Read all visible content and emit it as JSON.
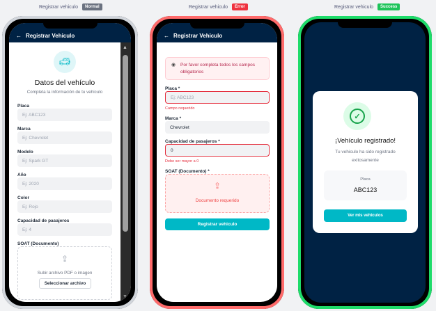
{
  "captions": [
    {
      "label": "Registrar vehiculo",
      "badge": "Normal",
      "badge_color": "#6b7280"
    },
    {
      "label": "Registrar vehiculo",
      "badge": "Error",
      "badge_color": "#ef3340"
    },
    {
      "label": "Registrar vehiculo",
      "badge": "Success",
      "badge_color": "#1ec45a"
    }
  ],
  "header_title": "Registrar Vehiculo",
  "normal": {
    "title": "Datos del vehículo",
    "subtitle": "Completa la información de tu vehiculo",
    "fields": [
      {
        "label": "Placa",
        "placeholder": "Ej: ABC123"
      },
      {
        "label": "Marca",
        "placeholder": "Ej: Chevrolet"
      },
      {
        "label": "Modelo",
        "placeholder": "Ej: Spark GT"
      },
      {
        "label": "Año",
        "placeholder": "Ej: 2020"
      },
      {
        "label": "Color",
        "placeholder": "Ej: Rojo"
      },
      {
        "label": "Capacidad de pasajeros",
        "placeholder": "Ej: 4"
      }
    ],
    "soat_label": "SOAT (Documento)",
    "upload_text": "Subir archivo PDF o imagen",
    "select_file": "Seleccionar archivo"
  },
  "error": {
    "alert": "Por favor completa todos los campos obligatorios",
    "placa_label": "Placa *",
    "placa_placeholder": "Ej: ABC123",
    "placa_error": "Campo requerido",
    "marca_label": "Marca *",
    "marca_value": "Chevrolet",
    "cap_label": "Capacidad de pasajeros *",
    "cap_value": "0",
    "cap_error": "Debe ser mayor a 0",
    "soat_label": "SOAT (Documento) *",
    "soat_error": "Documento requerido",
    "submit": "Registrar vehiculo"
  },
  "success": {
    "title": "¡Vehículo registrado!",
    "message": "Tu vehiculo ha sido registrado exitosamente",
    "placa_label": "Placa",
    "placa_value": "ABC123",
    "button": "Ver mis vehiculos"
  }
}
